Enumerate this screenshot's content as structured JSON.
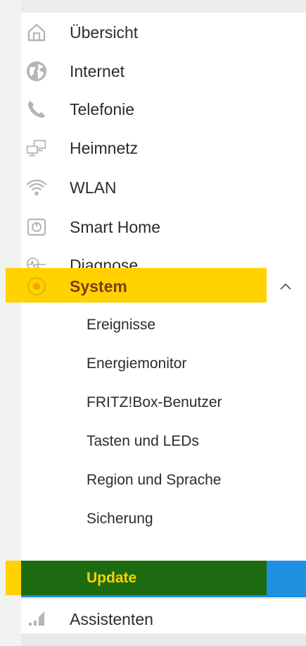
{
  "colors": {
    "highlight_yellow": "#ffd200",
    "update_green": "#1d6b10",
    "update_blue": "#1f8fe0",
    "icon_gray": "#b5b5b5",
    "system_text": "#7a3e12"
  },
  "nav": {
    "items": [
      {
        "label": "Übersicht",
        "icon": "home-icon"
      },
      {
        "label": "Internet",
        "icon": "globe-icon"
      },
      {
        "label": "Telefonie",
        "icon": "phone-icon"
      },
      {
        "label": "Heimnetz",
        "icon": "network-icon"
      },
      {
        "label": "WLAN",
        "icon": "wifi-icon"
      },
      {
        "label": "Smart Home",
        "icon": "smart-home-icon"
      },
      {
        "label": "Diagnose",
        "icon": "diagnose-icon"
      },
      {
        "label": "System",
        "icon": "system-icon",
        "expanded": true
      },
      {
        "label": "Assistenten",
        "icon": "assistant-icon"
      }
    ],
    "system_subitems": [
      "Ereignisse",
      "Energiemonitor",
      "FRITZ!Box-Benutzer",
      "Tasten und LEDs",
      "Region und Sprache",
      "Sicherung",
      "Update"
    ],
    "active_subitem": "Update"
  }
}
